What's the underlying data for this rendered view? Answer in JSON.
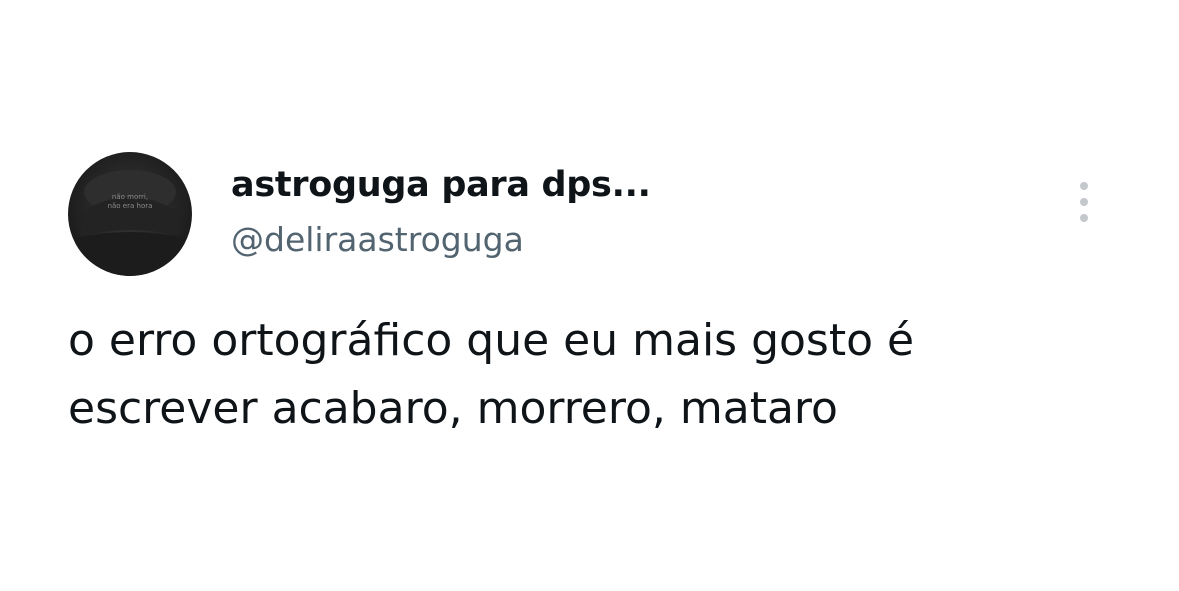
{
  "author": {
    "display_name": "astroguga para dps...",
    "handle": "@deliraastroguga",
    "avatar_caption_line1": "não morri,",
    "avatar_caption_line2": "não era hora"
  },
  "more_options_icon": "vertical-ellipsis-icon",
  "tweet": {
    "text_line1": "o erro ortográfico que eu mais gosto é",
    "text_line2": "escrever acabaro, morrero, mataro"
  }
}
